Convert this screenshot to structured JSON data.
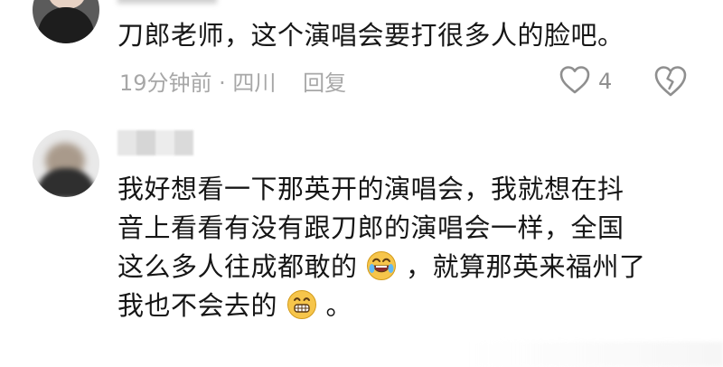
{
  "comments": [
    {
      "text": "刀郎老师，这个演唱会要打很多人的脸吧。",
      "time": "19分钟前 · 四川",
      "reply_label": "回复",
      "like_count": "4"
    },
    {
      "lines": [
        "我好想看一下那英开的演唱会，我就想在抖",
        "音上看看有没有跟刀郎的演唱会一样，全国"
      ],
      "line3_before": "这么多人往成都敢的",
      "line3_after": "，就算那英来福州了",
      "line4_before": "我也不会去的",
      "line4_after": "。",
      "emoji_1": "crying-laughing-face",
      "emoji_2": "grinning-face"
    }
  ],
  "colors": {
    "text_primary": "#161616",
    "text_meta": "#a7a7a7",
    "icon_gray": "#8f8f8f",
    "emoji_yellow": "#f6c54b"
  }
}
